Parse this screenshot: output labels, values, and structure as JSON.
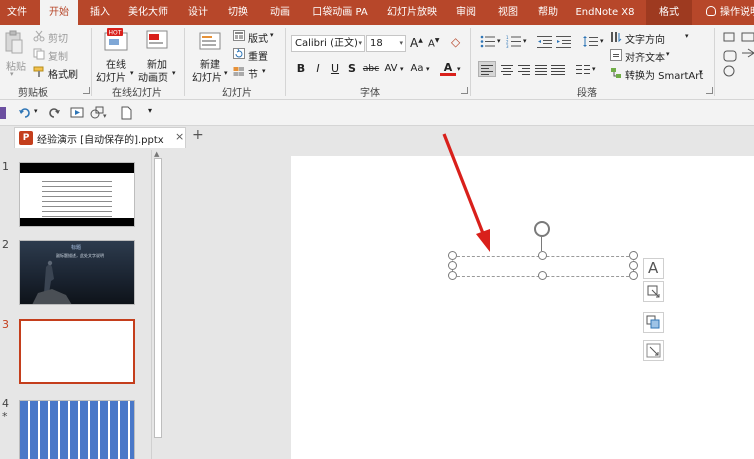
{
  "tabs": [
    {
      "label": "文件"
    },
    {
      "label": "开始",
      "active": true
    },
    {
      "label": "插入"
    },
    {
      "label": "美化大师"
    },
    {
      "label": "设计"
    },
    {
      "label": "切换"
    },
    {
      "label": "动画"
    },
    {
      "label": "口袋动画 PA"
    },
    {
      "label": "幻灯片放映"
    },
    {
      "label": "审阅"
    },
    {
      "label": "视图"
    },
    {
      "label": "帮助"
    },
    {
      "label": "EndNote X8"
    },
    {
      "label": "格式"
    }
  ],
  "tell_me": "操作说明",
  "ribbon": {
    "clipboard": {
      "paste": "粘贴",
      "cut": "剪切",
      "copy": "复制",
      "format_painter": "格式刷",
      "group": "剪贴板"
    },
    "online_slides": {
      "online": "在线",
      "online2": "幻灯片",
      "new_page": "新加",
      "new_page2": "动画页",
      "group": "在线幻灯片"
    },
    "slides": {
      "new": "新建",
      "new2": "幻灯片",
      "layout": "版式",
      "reset": "重置",
      "section": "节",
      "group": "幻灯片"
    },
    "font": {
      "family": "Calibri (正文)",
      "size": "18",
      "bold": "B",
      "italic": "I",
      "underline": "U",
      "shadow": "S",
      "strike": "abc",
      "spacing": "AV",
      "case": "Aa",
      "color": "A",
      "group": "字体"
    },
    "paragraph": {
      "text_direction": "文字方向",
      "align_text": "对齐文本",
      "smartart": "转换为 SmartArt",
      "group": "段落"
    }
  },
  "doc_tab": {
    "name": "经验演示 [自动保存的].pptx",
    "close": "×",
    "add": "+"
  },
  "slides": [
    {
      "number": "1",
      "title": "",
      "active": false
    },
    {
      "number": "2",
      "title": "标题",
      "subtitle": "副标题描述，此处文字说明",
      "active": false
    },
    {
      "number": "3",
      "active": true
    },
    {
      "number": "4",
      "star": "*",
      "active": false
    }
  ],
  "colors": {
    "accent": "#b7472a",
    "arrow": "#d9201b"
  }
}
